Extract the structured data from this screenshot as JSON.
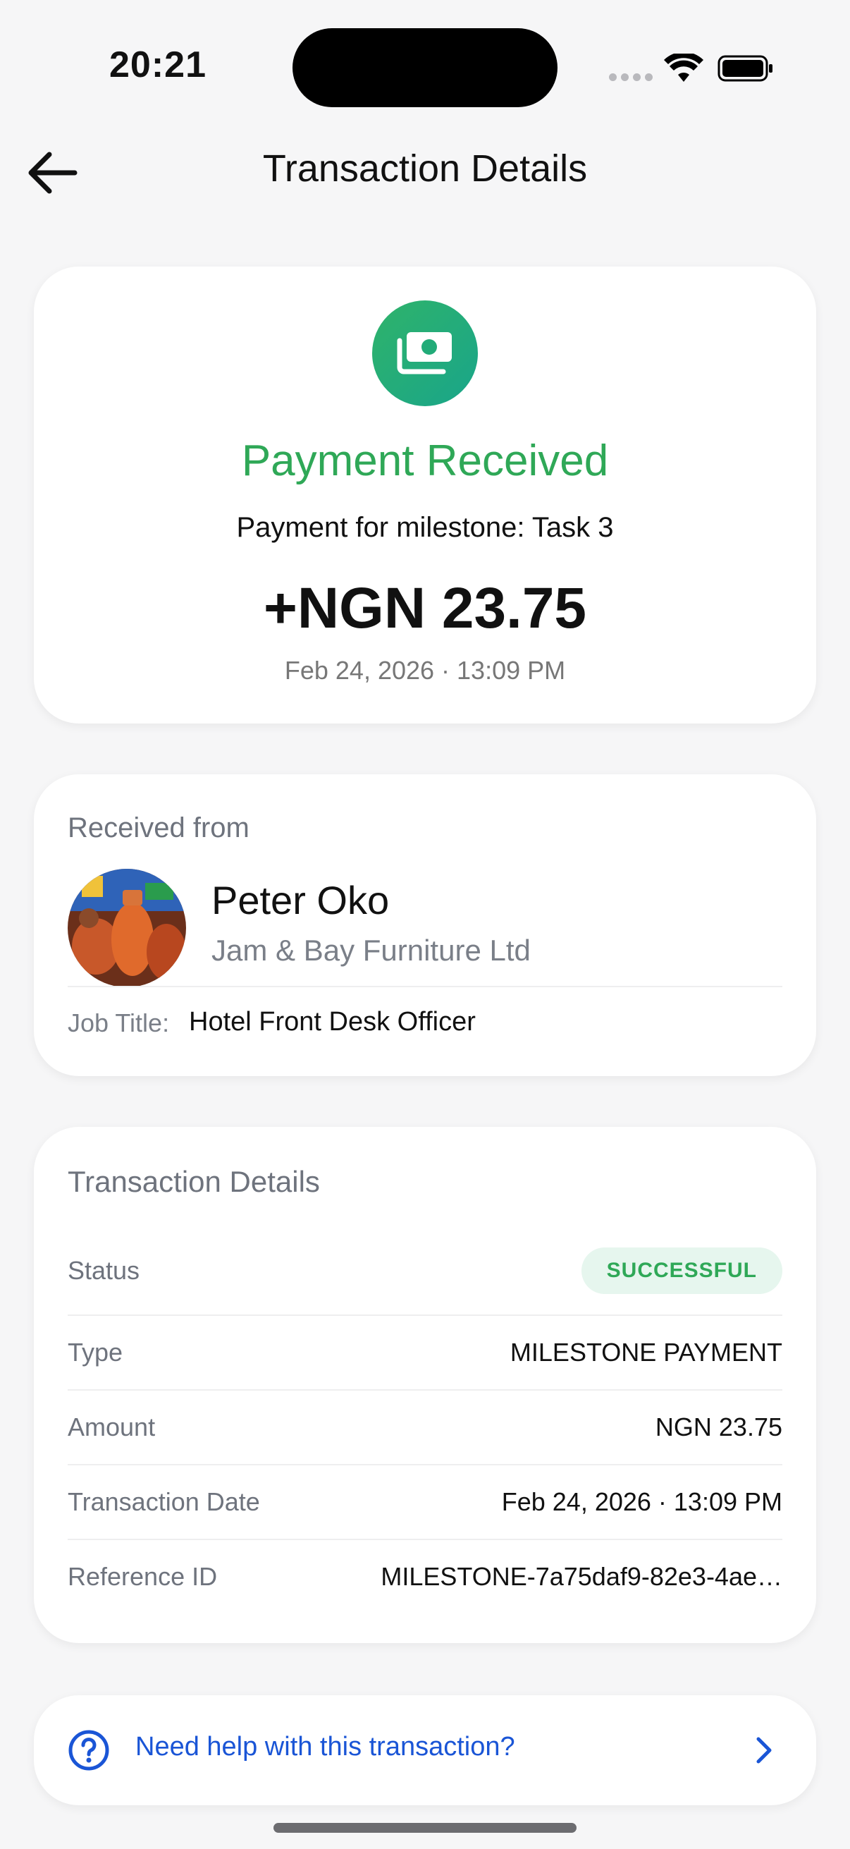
{
  "status_bar": {
    "time": "20:21"
  },
  "header": {
    "title": "Transaction Details"
  },
  "payment": {
    "icon": "cash-icon",
    "title": "Payment Received",
    "subtitle": "Payment for milestone: Task 3",
    "amount": "+NGN 23.75",
    "datetime": "Feb 24, 2026 · 13:09 PM",
    "accent_color": "#2fa857"
  },
  "from": {
    "label": "Received from",
    "name": "Peter Oko",
    "company": "Jam & Bay Furniture Ltd",
    "job_label": "Job Title:",
    "job_value": "Hotel Front Desk Officer"
  },
  "details": {
    "title": "Transaction Details",
    "rows": [
      {
        "label": "Status",
        "value": "SUCCESSFUL"
      },
      {
        "label": "Type",
        "value": "MILESTONE PAYMENT"
      },
      {
        "label": "Amount",
        "value": "NGN 23.75"
      },
      {
        "label": "Transaction Date",
        "value": "Feb 24, 2026 · 13:09 PM"
      },
      {
        "label": "Reference ID",
        "value": "MILESTONE-7a75daf9-82e3-4ae…"
      }
    ]
  },
  "help": {
    "text": "Need help with this transaction?",
    "link_color": "#1a55d6"
  }
}
